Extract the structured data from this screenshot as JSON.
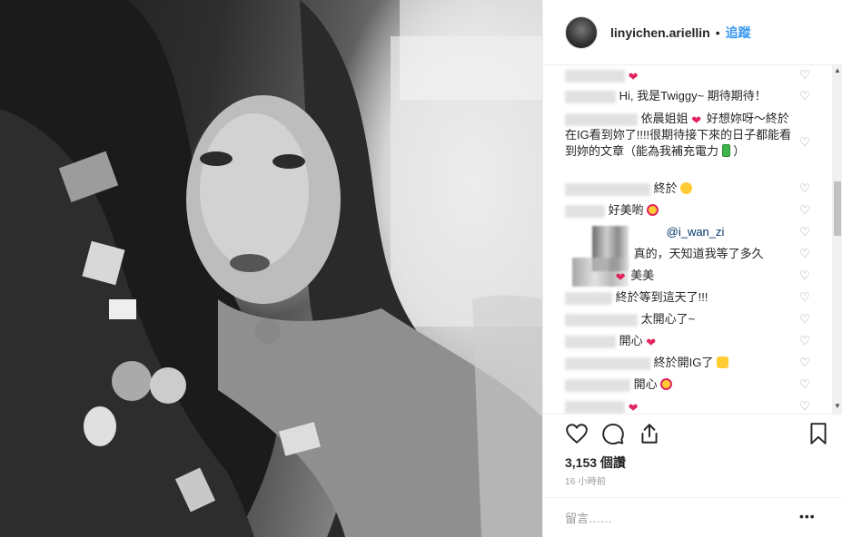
{
  "post": {
    "username": "linyichen.ariellin",
    "separator": "•",
    "follow_label": "追蹤"
  },
  "comments": [
    {
      "text": "",
      "emoji": "red-heart"
    },
    {
      "text": "Hi, 我是Twiggy~ 期待期待！"
    },
    {
      "text": "依晨姐姐",
      "text2": "好想妳呀～終於在IG看到妳了!!!!很期待接下來的日子都能看到妳的文章（能為我補充電力",
      "text3": "）"
    },
    {
      "text": "終於",
      "emoji": "rofl-face"
    },
    {
      "text": "好美喲 ",
      "emoji": "star-struck-face"
    },
    {
      "text": "@i_wan_zi"
    },
    {
      "text": "真的，天知道我等了多久"
    },
    {
      "text": "美美",
      "emoji": "red-heart"
    },
    {
      "text": "終於等到這天了!!!"
    },
    {
      "text": "太開心了~"
    },
    {
      "text": "開心",
      "emoji": "red-heart"
    },
    {
      "text": "終於開IG了",
      "emoji": "raised-hands"
    },
    {
      "text": "開心",
      "emoji": "star-struck-face"
    },
    {
      "text": "",
      "emoji": "red-heart"
    }
  ],
  "actions": {
    "like_icon": "heart-outline-icon",
    "comment_icon": "comment-bubble-icon",
    "share_icon": "share-upload-icon",
    "save_icon": "bookmark-icon"
  },
  "stats": {
    "likes": "3,153 個讚",
    "time": "16 小時前"
  },
  "add_comment": {
    "placeholder": "留言……",
    "more_label": "•••"
  }
}
